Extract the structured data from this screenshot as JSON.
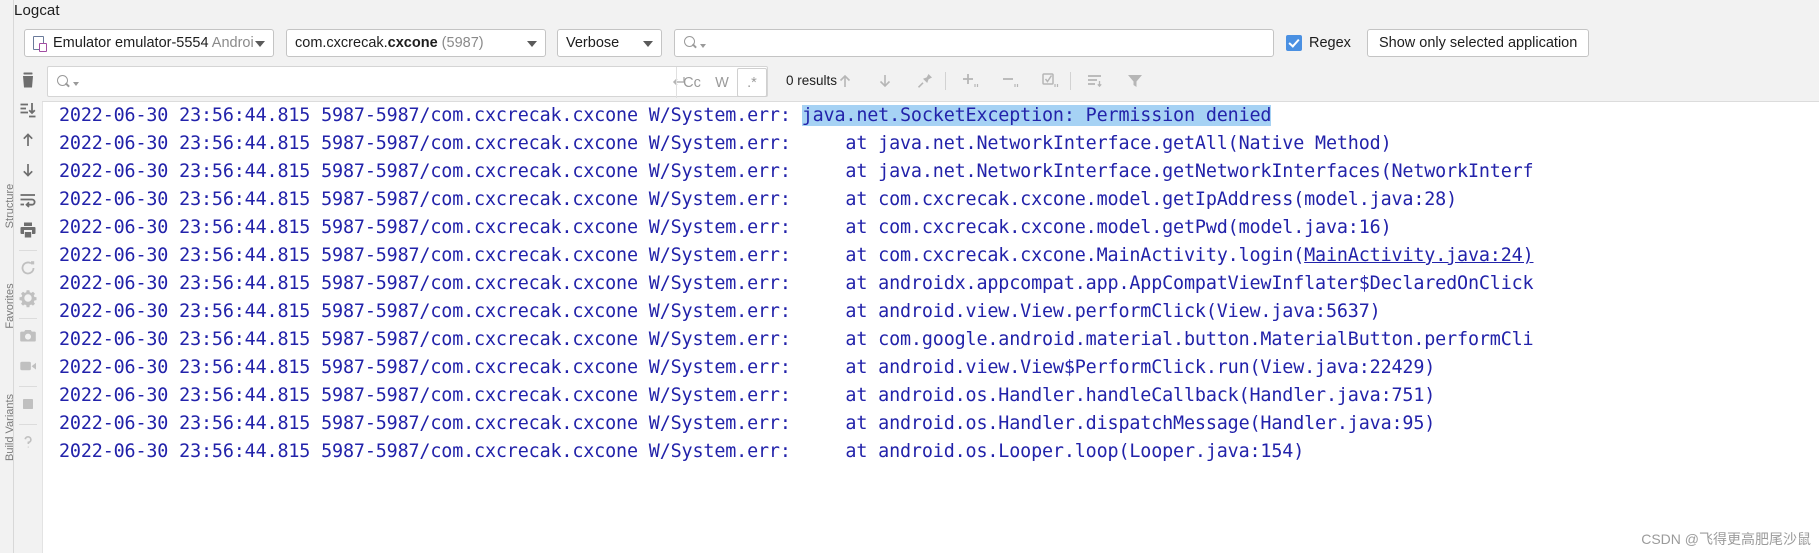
{
  "panel": {
    "tab_label": "Logcat"
  },
  "side_rail": {
    "labels": [
      "Structure",
      "Favorites",
      "Build Variants"
    ]
  },
  "filter_bar": {
    "device": {
      "icon": "device-icon",
      "text_main": "Emulator emulator-5554",
      "text_dim": "Android"
    },
    "process": {
      "prefix": "com.cxcrecak.",
      "bold": "cxcone",
      "suffix": " (5987)"
    },
    "log_level": "Verbose",
    "search_placeholder": "",
    "search_value": "",
    "regex_label": "Regex",
    "regex_checked": true,
    "show_only_selected_application": "Show only selected application"
  },
  "find_bar": {
    "find_value": "",
    "find_placeholder": "",
    "options": [
      {
        "name": "match-case",
        "label": "Cc",
        "active": false
      },
      {
        "name": "words",
        "label": "W",
        "active": false
      },
      {
        "name": "regex",
        "label": ".*",
        "active": true
      }
    ],
    "results_text": "0 results",
    "icons": [
      "arrow-up-icon",
      "arrow-down-icon",
      "pin-icon",
      "expand-all-icon",
      "collapse-all-icon",
      "select-all-occurrences-icon",
      "soft-wrap-icon",
      "filter-icon"
    ],
    "newline_icon": "new-line-icon",
    "search_icon": "search-icon"
  },
  "tool_column": {
    "icons": [
      "clear-logcat-icon",
      "scroll-to-end-icon",
      "up-the-stack-trace-icon",
      "down-the-stack-trace-icon",
      "soft-wrap-icon",
      "print-icon",
      "restart-icon",
      "settings-gear-icon",
      "screenshot-camera-icon",
      "screen-record-icon",
      "stop-icon",
      "help-question-icon"
    ]
  },
  "log": {
    "timestamp": "2022-06-30 23:56:44.815",
    "pid_tid": "5987-5987",
    "package": "com.cxcrecak.cxcone",
    "tag": "W/System.err:",
    "highlight_color": "#a6d2f4",
    "text_color": "#2222aa",
    "lines": [
      {
        "prefix": "2022-06-30 23:56:44.815 5987-5987/com.cxcrecak.cxcone W/System.err: ",
        "highlight": "java.net.SocketException: Permission denied",
        "message": "",
        "link": ""
      },
      {
        "prefix": "2022-06-30 23:56:44.815 5987-5987/com.cxcrecak.cxcone W/System.err: ",
        "highlight": "",
        "message": "    at java.net.NetworkInterface.getAll(Native Method)",
        "link": ""
      },
      {
        "prefix": "2022-06-30 23:56:44.815 5987-5987/com.cxcrecak.cxcone W/System.err: ",
        "highlight": "",
        "message": "    at java.net.NetworkInterface.getNetworkInterfaces(NetworkInterf",
        "link": ""
      },
      {
        "prefix": "2022-06-30 23:56:44.815 5987-5987/com.cxcrecak.cxcone W/System.err: ",
        "highlight": "",
        "message": "    at com.cxcrecak.cxcone.model.getIpAddress(model.java:28)",
        "link": ""
      },
      {
        "prefix": "2022-06-30 23:56:44.815 5987-5987/com.cxcrecak.cxcone W/System.err: ",
        "highlight": "",
        "message": "    at com.cxcrecak.cxcone.model.getPwd(model.java:16)",
        "link": ""
      },
      {
        "prefix": "2022-06-30 23:56:44.815 5987-5987/com.cxcrecak.cxcone W/System.err: ",
        "highlight": "",
        "message": "    at com.cxcrecak.cxcone.MainActivity.login(",
        "link": "MainActivity.java:24)"
      },
      {
        "prefix": "2022-06-30 23:56:44.815 5987-5987/com.cxcrecak.cxcone W/System.err: ",
        "highlight": "",
        "message": "    at androidx.appcompat.app.AppCompatViewInflater$DeclaredOnClick",
        "link": ""
      },
      {
        "prefix": "2022-06-30 23:56:44.815 5987-5987/com.cxcrecak.cxcone W/System.err: ",
        "highlight": "",
        "message": "    at android.view.View.performClick(View.java:5637)",
        "link": ""
      },
      {
        "prefix": "2022-06-30 23:56:44.815 5987-5987/com.cxcrecak.cxcone W/System.err: ",
        "highlight": "",
        "message": "    at com.google.android.material.button.MaterialButton.performCli",
        "link": ""
      },
      {
        "prefix": "2022-06-30 23:56:44.815 5987-5987/com.cxcrecak.cxcone W/System.err: ",
        "highlight": "",
        "message": "    at android.view.View$PerformClick.run(View.java:22429)",
        "link": ""
      },
      {
        "prefix": "2022-06-30 23:56:44.815 5987-5987/com.cxcrecak.cxcone W/System.err: ",
        "highlight": "",
        "message": "    at android.os.Handler.handleCallback(Handler.java:751)",
        "link": ""
      },
      {
        "prefix": "2022-06-30 23:56:44.815 5987-5987/com.cxcrecak.cxcone W/System.err: ",
        "highlight": "",
        "message": "    at android.os.Handler.dispatchMessage(Handler.java:95)",
        "link": ""
      },
      {
        "prefix": "2022-06-30 23:56:44.815 5987-5987/com.cxcrecak.cxcone W/System.err: ",
        "highlight": "",
        "message": "    at android.os.Looper.loop(Looper.java:154)",
        "link": ""
      }
    ]
  },
  "watermark": {
    "text": "CSDN @飞得更高肥尾沙鼠"
  }
}
